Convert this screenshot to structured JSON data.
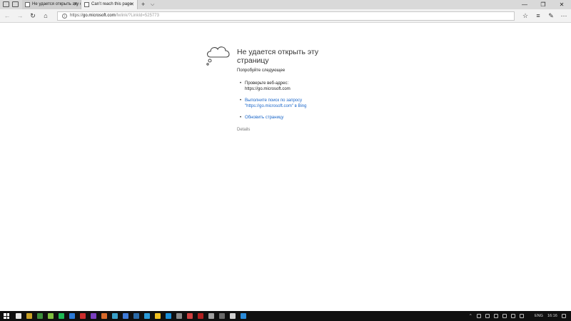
{
  "tabs": [
    {
      "label": "Не удается открыть эту стр",
      "active": false
    },
    {
      "label": "Can’t reach this page",
      "active": true
    }
  ],
  "tab_close_symbol": "✕",
  "new_tab_symbol": "+",
  "tab_list_symbol": "⌵",
  "window_controls": {
    "minimize": "—",
    "maximize": "❐",
    "close": "✕"
  },
  "nav": {
    "back": "←",
    "forward": "→",
    "refresh": "↻",
    "home": "⌂"
  },
  "address": {
    "host_prefix": "https://",
    "host": "go.microsoft.com",
    "path": "/fwlink/?LinkId=525773",
    "info_symbol": "i"
  },
  "toolbar_right": {
    "favorites": "☆",
    "hub": "≡",
    "notes": "✎",
    "share": "⇧",
    "more": "···"
  },
  "error": {
    "title": "Не удается открыть эту страницу",
    "subtitle": "Попробуйте следующее",
    "check_label": "Проверьте веб-адрес:",
    "check_url": "https://go.microsoft.com",
    "search_link_line1": "Выполните поиск по запросу",
    "search_link_line2": "\"https://go.microsoft.com\" в Bing",
    "refresh_link": "Обновить страницу",
    "details": "Details"
  },
  "taskbar": {
    "language": "ENG",
    "time": "16:16",
    "app_colors": [
      "#e8e8e8",
      "#c9a227",
      "#3b8e3b",
      "#7fbf3f",
      "#1db954",
      "#2a7ad8",
      "#cc2d2d",
      "#7b3fbf",
      "#d86a2a",
      "#3aa0c8",
      "#3f7bd8",
      "#2a6aa8",
      "#2a9ad8",
      "#f0c020",
      "#1a8fd8",
      "#888888",
      "#d04040",
      "#b02020",
      "#a0a0a0",
      "#6a6a6a",
      "#d0d0d0",
      "#2a8ad8"
    ]
  }
}
